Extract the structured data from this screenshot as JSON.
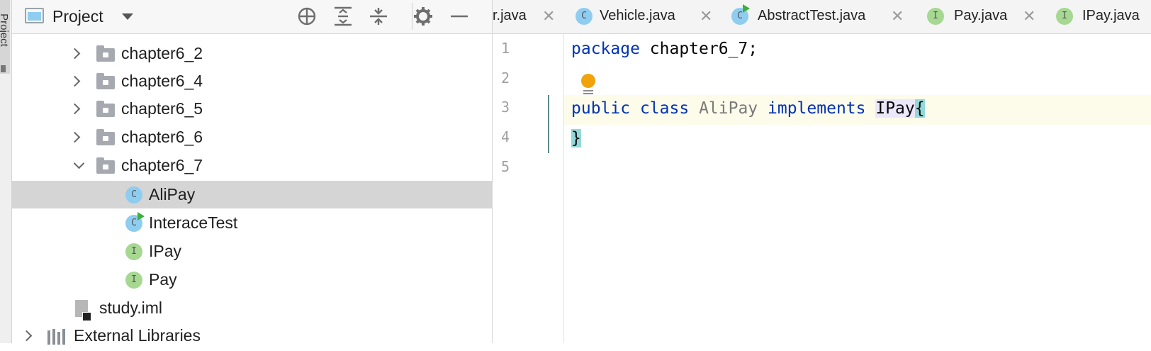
{
  "sidebar_strip": {
    "label": "Project"
  },
  "project_panel": {
    "title": "Project",
    "toolbar": {
      "locate_icon": "crosshair-icon",
      "expand_icon": "expand-all-icon",
      "collapse_icon": "collapse-all-icon",
      "settings_icon": "gear-icon",
      "hide_icon": "minimize-icon"
    },
    "tree": [
      {
        "label": "chapter6_2",
        "type": "package",
        "expanded": false
      },
      {
        "label": "chapter6_4",
        "type": "package",
        "expanded": false
      },
      {
        "label": "chapter6_5",
        "type": "package",
        "expanded": false
      },
      {
        "label": "chapter6_6",
        "type": "package",
        "expanded": false
      },
      {
        "label": "chapter6_7",
        "type": "package",
        "expanded": true
      },
      {
        "label": "AliPay",
        "type": "class",
        "badge": "C",
        "selected": true
      },
      {
        "label": "InteraceTest",
        "type": "class-runnable",
        "badge": "C"
      },
      {
        "label": "IPay",
        "type": "interface",
        "badge": "I"
      },
      {
        "label": "Pay",
        "type": "interface",
        "badge": "I"
      },
      {
        "label": "study.iml",
        "type": "module-file"
      },
      {
        "label": "External Libraries",
        "type": "libraries",
        "expanded": false
      }
    ]
  },
  "tabs": [
    {
      "label": "r.java",
      "icon": "none",
      "closable": true
    },
    {
      "label": "Vehicle.java",
      "icon": "class-icon",
      "badge": "C",
      "closable": true
    },
    {
      "label": "AbstractTest.java",
      "icon": "runnable-class-icon",
      "badge": "C",
      "closable": true
    },
    {
      "label": "Pay.java",
      "icon": "interface-icon",
      "badge": "I",
      "closable": true
    },
    {
      "label": "IPay.java",
      "icon": "interface-icon",
      "badge": "I",
      "closable": false
    }
  ],
  "editor": {
    "line_numbers": [
      "1",
      "2",
      "3",
      "4",
      "5"
    ],
    "code": {
      "line1_kw": "package",
      "line1_rest": " chapter6_7;",
      "line3_kw1": "public",
      "line3_kw2": "class",
      "line3_name": "AliPay",
      "line3_kw3": "implements",
      "line3_ref": "IPay",
      "line3_brace": "{",
      "line4_brace": "}"
    },
    "intention_icon": "lightbulb-icon"
  },
  "colors": {
    "keyword": "#0033b3",
    "class_badge": "#8fcdf0",
    "interface_badge": "#a6d892",
    "selection": "#d5d5d5",
    "brace_match": "#93d9d9",
    "current_line": "#fdfbea"
  }
}
